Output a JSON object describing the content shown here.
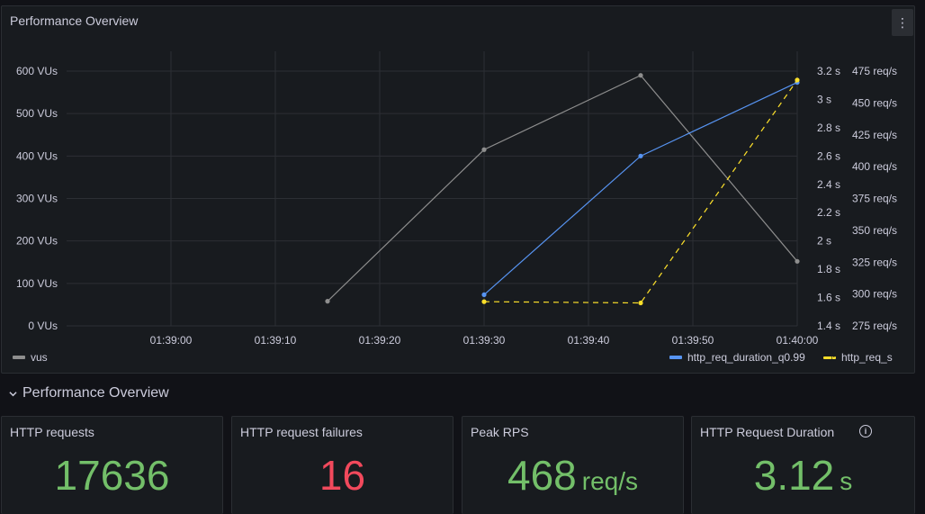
{
  "chart_panel": {
    "title": "Performance Overview",
    "menu_icon": "kebab-icon"
  },
  "chart_data": {
    "type": "line",
    "title": "Performance Overview",
    "x_ticks": [
      "01:39:00",
      "01:39:10",
      "01:39:20",
      "01:39:30",
      "01:39:40",
      "01:39:50",
      "01:40:00"
    ],
    "xlim": [
      "01:38:50",
      "01:40:00"
    ],
    "axes": {
      "left": {
        "ticks": [
          "0 VUs",
          "100 VUs",
          "200 VUs",
          "300 VUs",
          "400 VUs",
          "500 VUs",
          "600 VUs"
        ],
        "ylim": [
          0,
          600
        ]
      },
      "right_duration": {
        "ticks": [
          "1.4 s",
          "1.6 s",
          "1.8 s",
          "2 s",
          "2.2 s",
          "2.4 s",
          "2.6 s",
          "2.8 s",
          "3 s",
          "3.2 s"
        ],
        "ylim": [
          1.4,
          3.2
        ]
      },
      "right_rps": {
        "ticks": [
          "275 req/s",
          "300 req/s",
          "325 req/s",
          "350 req/s",
          "375 req/s",
          "400 req/s",
          "425 req/s",
          "450 req/s",
          "475 req/s"
        ],
        "ylim": [
          275,
          475
        ]
      }
    },
    "grid": true,
    "legend_placement": "bottom",
    "series": [
      {
        "name": "vus",
        "axis": "left",
        "color": "#8e8e8e",
        "style": "solid",
        "x": [
          "01:39:15",
          "01:39:30",
          "01:39:45",
          "01:40:00"
        ],
        "values": [
          58,
          415,
          590,
          152
        ]
      },
      {
        "name": "http_req_duration_q0.99",
        "axis": "right_duration",
        "color": "#5794f2",
        "style": "solid",
        "x": [
          "01:39:30",
          "01:39:45",
          "01:40:00"
        ],
        "values": [
          1.62,
          2.6,
          3.12
        ]
      },
      {
        "name": "http_req_s",
        "axis": "right_rps",
        "color": "#fade2a",
        "style": "dashed",
        "x": [
          "01:39:30",
          "01:39:45",
          "01:40:00"
        ],
        "values": [
          294,
          293,
          468
        ]
      }
    ]
  },
  "section": {
    "title": "Performance Overview",
    "chevron_icon": "chevron-down-icon"
  },
  "stats": [
    {
      "title": "HTTP requests",
      "value": "17636",
      "unit": "",
      "color": "#73bf69"
    },
    {
      "title": "HTTP request failures",
      "value": "16",
      "unit": "",
      "color": "#f2495c"
    },
    {
      "title": "Peak RPS",
      "value": "468",
      "unit": "req/s",
      "color": "#73bf69"
    },
    {
      "title": "HTTP Request Duration",
      "value": "3.12",
      "unit": "s",
      "color": "#73bf69",
      "info_icon": "info-icon"
    }
  ]
}
